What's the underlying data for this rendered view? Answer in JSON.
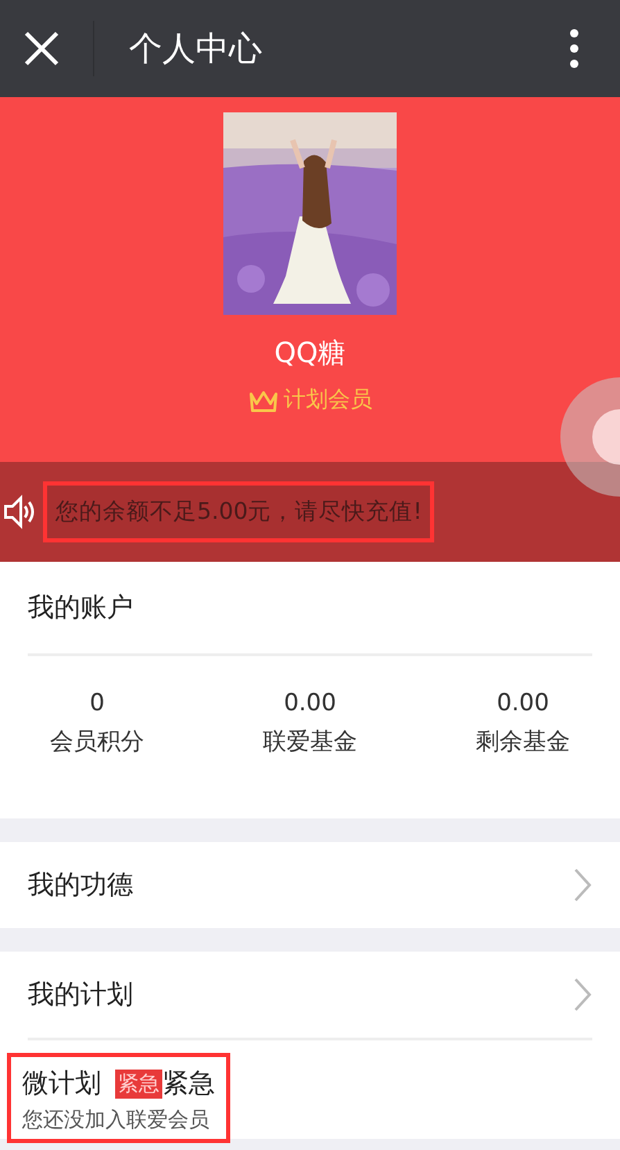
{
  "top_bar": {
    "title": "个人中心"
  },
  "profile": {
    "name": "QQ糖",
    "member_level": "计划会员"
  },
  "notice": {
    "text": "您的余额不足5.00元，请尽快充值!",
    "highlighted": true
  },
  "account": {
    "title": "我的账户",
    "stats": [
      {
        "value": "0",
        "label": "会员积分"
      },
      {
        "value": "0.00",
        "label": "联爱基金"
      },
      {
        "value": "0.00",
        "label": "剩余基金"
      }
    ]
  },
  "menu": [
    {
      "label": "我的功德"
    },
    {
      "label": "我的计划"
    }
  ],
  "plans": [
    {
      "title": "微计划",
      "tag": "紧急",
      "tag_text": "紧急",
      "note": "您还没加入联爱会员",
      "highlighted": true
    }
  ]
}
